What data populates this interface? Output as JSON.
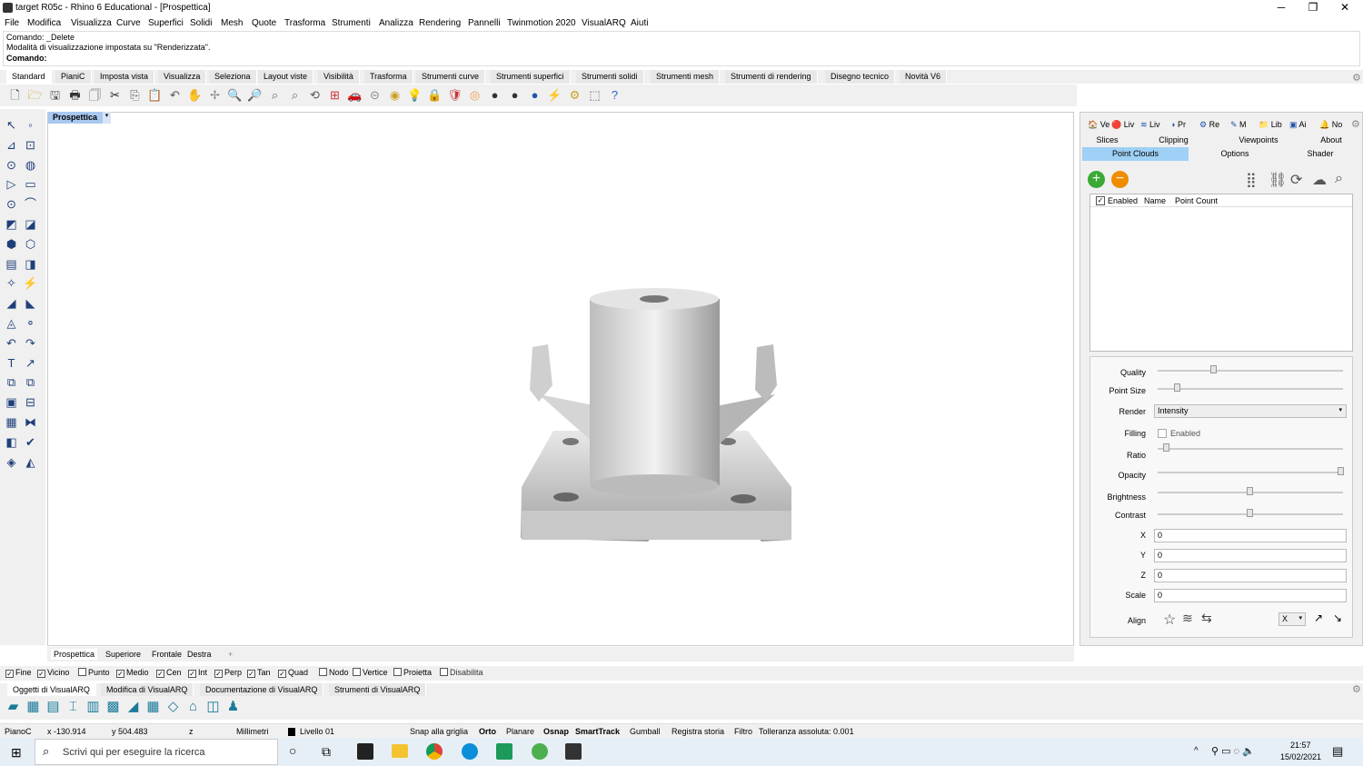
{
  "window": {
    "title": "target R05c - Rhino 6 Educational - [Prospettica]",
    "minimize": "─",
    "maximize": "❐",
    "close": "✕"
  },
  "menu": [
    "File",
    "Modifica",
    "Visualizza",
    "Curve",
    "Superfici",
    "Solidi",
    "Mesh",
    "Quote",
    "Trasforma",
    "Strumenti",
    "Analizza",
    "Rendering",
    "Pannelli",
    "Twinmotion 2020",
    "VisualARQ",
    "Aiuti"
  ],
  "command": {
    "line1": "Comando: _Delete",
    "line2": "Modalità di visualizzazione impostata su \"Renderizzata\".",
    "prompt": "Comando:"
  },
  "tabs": [
    "Standard",
    "PianiC",
    "Imposta vista",
    "Visualizza",
    "Seleziona",
    "Layout viste",
    "Visibilità",
    "Trasforma",
    "Strumenti curve",
    "Strumenti superfici",
    "Strumenti solidi",
    "Strumenti mesh",
    "Strumenti di rendering",
    "Disegno tecnico",
    "Novità V6"
  ],
  "viewport": {
    "active_label": "Prospettica",
    "dropdown": "▾"
  },
  "viewport_tabs": [
    "Prospettica",
    "Superiore",
    "Frontale",
    "Destra"
  ],
  "viewport_add": "+",
  "osnaps": [
    {
      "label": "Fine",
      "checked": true
    },
    {
      "label": "Vicino",
      "checked": true
    },
    {
      "label": "Punto",
      "checked": false
    },
    {
      "label": "Medio",
      "checked": true
    },
    {
      "label": "Cen",
      "checked": true
    },
    {
      "label": "Int",
      "checked": true
    },
    {
      "label": "Perp",
      "checked": true
    },
    {
      "label": "Tan",
      "checked": true
    },
    {
      "label": "Quad",
      "checked": true
    },
    {
      "label": "Nodo",
      "checked": false
    },
    {
      "label": "Vertice",
      "checked": false
    },
    {
      "label": "Proietta",
      "checked": false
    },
    {
      "label": "Disabilita",
      "checked": false
    }
  ],
  "va_tabs": [
    "Oggetti di VisualARQ",
    "Modifica di VisualARQ",
    "Documentazione di VisualARQ",
    "Strumenti di VisualARQ"
  ],
  "status": {
    "cplane": "PianoC",
    "x": "x -130.914",
    "y": "y 504.483",
    "z": "z",
    "units": "Millimetri",
    "layer": "Livello 01",
    "snap": "Snap alla griglia",
    "ortho": "Orto",
    "planar": "Planare",
    "osnap": "Osnap",
    "smarttrack": "SmartTrack",
    "gumball": "Gumball",
    "history": "Registra storia",
    "filter": "Filtro",
    "tolerance": "Tolleranza assoluta: 0.001"
  },
  "panel": {
    "top_tabs": [
      "Ve",
      "Liv",
      "Liv",
      "Pr",
      "Re",
      "M",
      "Lib",
      "Ai",
      "No"
    ],
    "sub_tabs_row1": [
      "Slices",
      "Clipping",
      "Viewpoints",
      "About"
    ],
    "sub_tabs_row2": [
      "Point Clouds",
      "Options",
      "Shader"
    ],
    "table_headers": [
      "Enabled",
      "Name",
      "Point Count"
    ],
    "props": {
      "quality": "Quality",
      "point_size": "Point Size",
      "render": "Render",
      "render_value": "Intensity",
      "filling": "Filling",
      "filling_enabled": "Enabled",
      "ratio": "Ratio",
      "opacity": "Opacity",
      "brightness": "Brightness",
      "contrast": "Contrast",
      "x": "X",
      "y": "Y",
      "z": "Z",
      "scale": "Scale",
      "x_val": "0",
      "y_val": "0",
      "z_val": "0",
      "scale_val": "0",
      "align": "Align",
      "align_axis": "X"
    },
    "sliders": {
      "quality": 0.3,
      "point_size": 0.1,
      "ratio": 0.04,
      "opacity": 1.0,
      "brightness": 0.5,
      "contrast": 0.5
    }
  },
  "taskbar": {
    "search_placeholder": "Scrivi qui per eseguire la ricerca",
    "time": "21:57",
    "date": "15/02/2021"
  }
}
